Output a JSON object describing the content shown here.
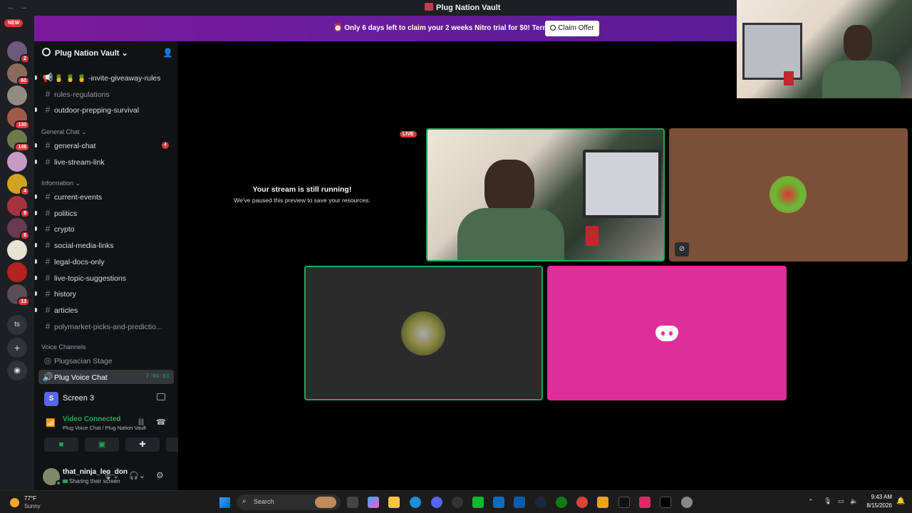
{
  "window": {
    "title": "Plug Nation Vault",
    "nav_back": "←",
    "nav_forward": "→"
  },
  "server_rail": {
    "new_badge": "NEW",
    "servers": [
      {
        "name": "server-1",
        "badge": "2",
        "color": "#6d5b7b"
      },
      {
        "name": "server-2",
        "badge": "60",
        "color": "#8b6c5c"
      },
      {
        "name": "server-3",
        "badge": "",
        "color": "#8f8c83"
      },
      {
        "name": "server-4",
        "badge": "130",
        "color": "#a05a4a"
      },
      {
        "name": "server-5",
        "badge": "148",
        "color": "#6c7a4a"
      },
      {
        "name": "server-6",
        "badge": "",
        "color": "#c79ac6"
      },
      {
        "name": "server-7",
        "badge": "4",
        "color": "#d1a31e"
      },
      {
        "name": "server-8",
        "badge": "8",
        "color": "#a3343d"
      },
      {
        "name": "server-9",
        "badge": "8",
        "color": "#6a3a4e"
      },
      {
        "name": "server-10",
        "badge": "",
        "color": "#e7e3d2"
      },
      {
        "name": "server-11",
        "badge": "",
        "color": "#b5241c"
      },
      {
        "name": "server-12",
        "badge": "13",
        "color": "#5a4e55"
      },
      {
        "name": "server-13",
        "badge": "",
        "color": "#4c7a3d"
      }
    ],
    "ts_label": "ts"
  },
  "banner": {
    "text": "⏰ Only 6 days left to claim your 2 weeks Nitro trial for $0! Terms apply.",
    "button": "Claim Offer"
  },
  "sidebar": {
    "guild_name": "Plug Nation Vault",
    "channels_top": [
      {
        "label": "🍍 🍍 🍍 -invite-giveaway-rules",
        "muted": false,
        "icon": "📢"
      },
      {
        "label": "rules-regulations",
        "muted": true,
        "icon": "#"
      },
      {
        "label": "outdoor-prepping-survival",
        "muted": false,
        "icon": "#"
      }
    ],
    "cat_general": "General Chat",
    "channels_general": [
      {
        "label": "general-chat",
        "badge": "4"
      },
      {
        "label": "live-stream-link",
        "badge": ""
      }
    ],
    "cat_information": "Information",
    "channels_info": [
      {
        "label": "current-events",
        "muted": false
      },
      {
        "label": "politics",
        "muted": false
      },
      {
        "label": "crypto",
        "muted": false
      },
      {
        "label": "social-media-links",
        "muted": false
      },
      {
        "label": "legal-docs-only",
        "muted": false
      },
      {
        "label": "live-topic-suggestions",
        "muted": false
      },
      {
        "label": "history",
        "muted": false
      },
      {
        "label": "articles",
        "muted": false
      },
      {
        "label": "polymarket-picks-and-predictio...",
        "muted": true
      }
    ],
    "cat_voice": "Voice Channels",
    "voice_stage": "Plugsacian Stage",
    "voice_chat": "Plug Voice Chat",
    "voice_timer": "7:04:61"
  },
  "screen_panel": {
    "icon_letter": "S",
    "label": "Screen 3"
  },
  "voice_panel": {
    "status": "Video Connected",
    "location": "Plug Voice Chat / Plug Nation Vault"
  },
  "user_panel": {
    "username": "that_ninja_leo_don",
    "status": "Sharing their screen"
  },
  "stage": {
    "paused_title": "Your stream is still running!",
    "paused_sub": "We've paused this preview to save your resources.",
    "live_label": "LIVE"
  },
  "taskbar": {
    "weather_temp": "77°F",
    "weather_desc": "Sunny",
    "search": "Search",
    "time": "9:43 AM",
    "date": "8/15/2026"
  },
  "colors": {
    "accent": "#5865f2",
    "discord_pink": "#de2e9a",
    "green": "#23a55a",
    "red": "#da373c"
  }
}
